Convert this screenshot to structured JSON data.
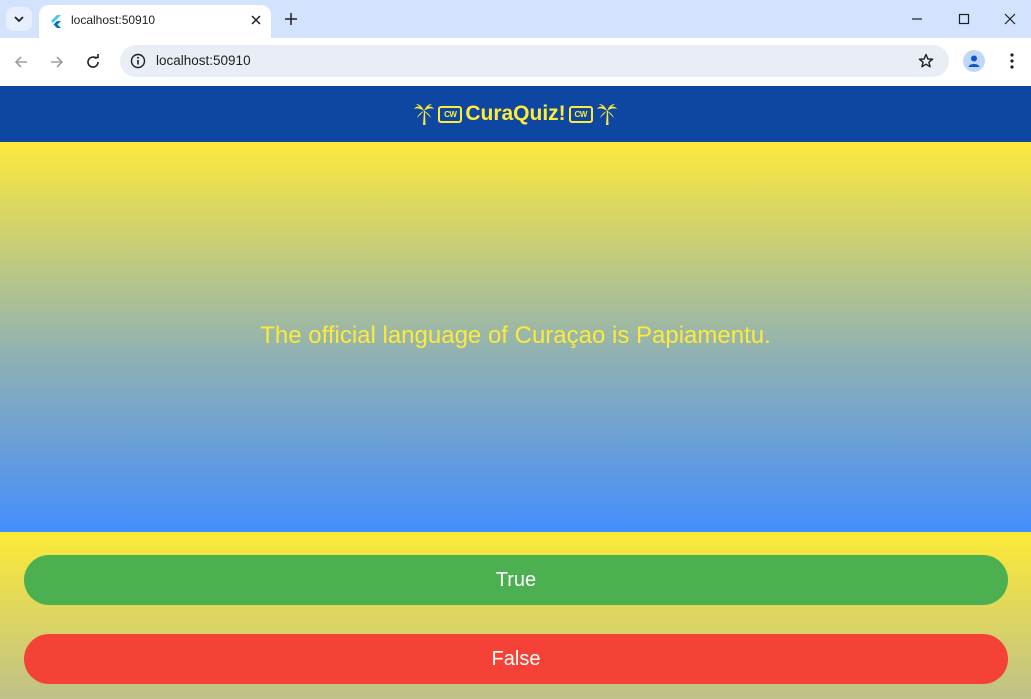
{
  "browser": {
    "tab_title": "localhost:50910",
    "url": "localhost:50910"
  },
  "app": {
    "title": "CuraQuiz!",
    "flag_label": "CW",
    "header_icons": [
      "palm-tree-icon",
      "curacao-flag-icon"
    ],
    "colors": {
      "appbar": "#0d47a1",
      "accent_yellow": "#ffeb3b",
      "true_button": "#4caf50",
      "false_button": "#f44336"
    }
  },
  "question": {
    "text": "The official language of Curaçao is Papiamentu."
  },
  "answers": {
    "true_label": "True",
    "false_label": "False"
  }
}
